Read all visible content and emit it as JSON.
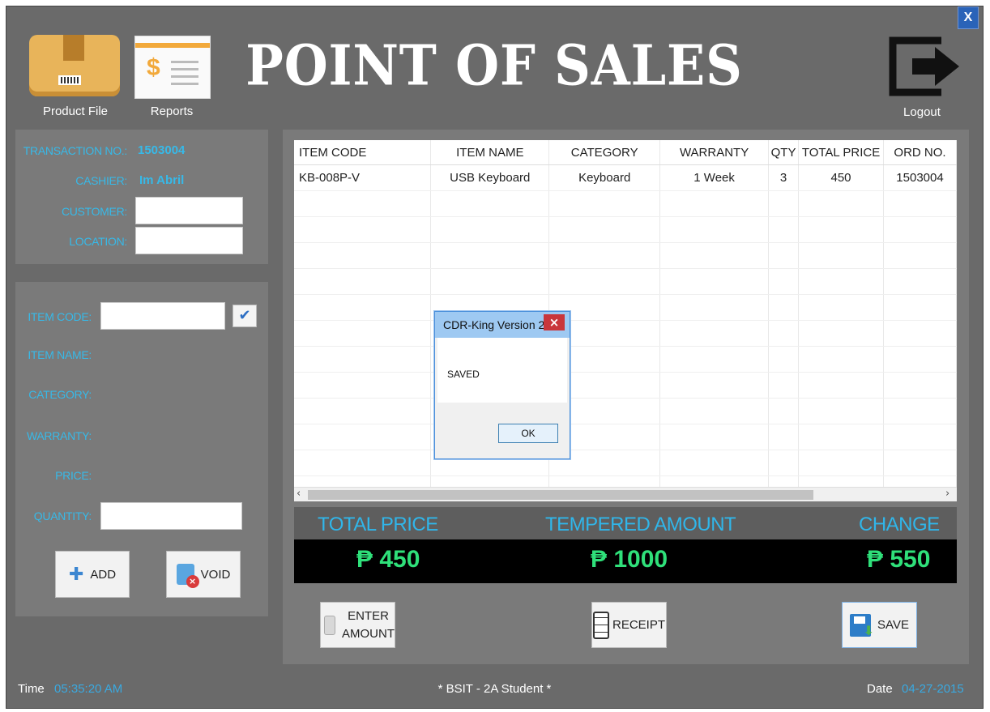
{
  "window": {
    "close_label": "X"
  },
  "header": {
    "title": "POINT OF SALES",
    "product_file_label": "Product File",
    "reports_label": "Reports",
    "logout_label": "Logout"
  },
  "transaction": {
    "transaction_no_label": "TRANSACTION NO.:",
    "transaction_no": "1503004",
    "cashier_label": "CASHIER:",
    "cashier": "Im Abril",
    "customer_label": "CUSTOMER:",
    "customer_value": "",
    "location_label": "LOCATION:",
    "location_value": ""
  },
  "item_form": {
    "item_code_label": "ITEM CODE:",
    "item_name_label": "ITEM NAME:",
    "category_label": "CATEGORY:",
    "warranty_label": "WARRANTY:",
    "price_label": "PRICE:",
    "quantity_label": "QUANTITY:",
    "add_label": "ADD",
    "void_label": "VOID"
  },
  "table": {
    "columns": [
      "ITEM CODE",
      "ITEM NAME",
      "CATEGORY",
      "WARRANTY",
      "QTY",
      "TOTAL PRICE",
      "ORD NO."
    ],
    "rows": [
      [
        "KB-008P-V",
        "USB Keyboard",
        "Keyboard",
        "1 Week",
        "3",
        "450",
        "1503004"
      ]
    ]
  },
  "summary": {
    "total_price_label": "TOTAL PRICE",
    "tempered_amount_label": "TEMPERED AMOUNT",
    "change_label": "CHANGE",
    "total_price": "₱ 450",
    "tempered_amount": "₱ 1000",
    "change": "₱ 550"
  },
  "actions": {
    "enter_amount_line1": "ENTER",
    "enter_amount_line2": "AMOUNT",
    "receipt_label": "RECEIPT",
    "save_label": "SAVE"
  },
  "dialog": {
    "title": "CDR-King Version 2",
    "message": "SAVED",
    "ok_label": "OK",
    "close_label": "×"
  },
  "status_bar": {
    "time_label": "Time",
    "time": "05:35:20 AM",
    "center_text": "* BSIT - 2A Student *",
    "date_label": "Date",
    "date": "04-27-2015"
  }
}
